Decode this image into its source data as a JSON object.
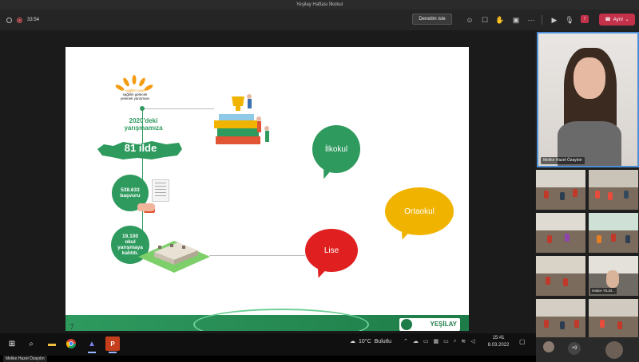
{
  "window": {
    "title": "Yeşilay Haftası İlkokul"
  },
  "toolbar": {
    "timer": "33:54",
    "control_button": "Denetim iste",
    "leave_button": "Ayrıl",
    "icons": [
      "people-icon",
      "chat-icon",
      "reactions-icon",
      "breakout-icon",
      "share-icon",
      "more-icon",
      "camera-icon",
      "mic-icon",
      "share-tray-icon"
    ]
  },
  "slide": {
    "brand_lines": [
      "sağlıklı nesil",
      "sağlıklı gelecek",
      "yelenek yarışması"
    ],
    "intro": "2020'deki yarışmamıza",
    "provinces": "81 ilde",
    "applications": [
      "538.633",
      "başvuru"
    ],
    "schools": [
      "19.100",
      "okul",
      "yarışmaya",
      "katıldı."
    ],
    "bubbles": {
      "ilkokul": "İlkokul",
      "ortaokul": "Ortaokul",
      "lise": "Lise"
    },
    "logo": "YEŞİLAY",
    "page_number": "7"
  },
  "participants": {
    "main_name": "Melike Hazel Özaydın",
    "tile_name": "Hatice YILDI...",
    "more_count": "+9"
  },
  "taskbar": {
    "weather_temp": "10°C",
    "weather_desc": "Bulutlu",
    "time": "15:41",
    "date": "8.03.2022",
    "apps": [
      "windows-icon",
      "search-icon",
      "file-explorer-icon",
      "chrome-icon",
      "teams-icon",
      "powerpoint-icon"
    ]
  },
  "bottom": {
    "presenter_name": "Melike Hazel Özaydın"
  },
  "colors": {
    "green": "#2e9a5e",
    "yellow": "#f0b400",
    "red": "#e02020",
    "leave": "#c4314b",
    "active_border": "#4c8fd6"
  }
}
